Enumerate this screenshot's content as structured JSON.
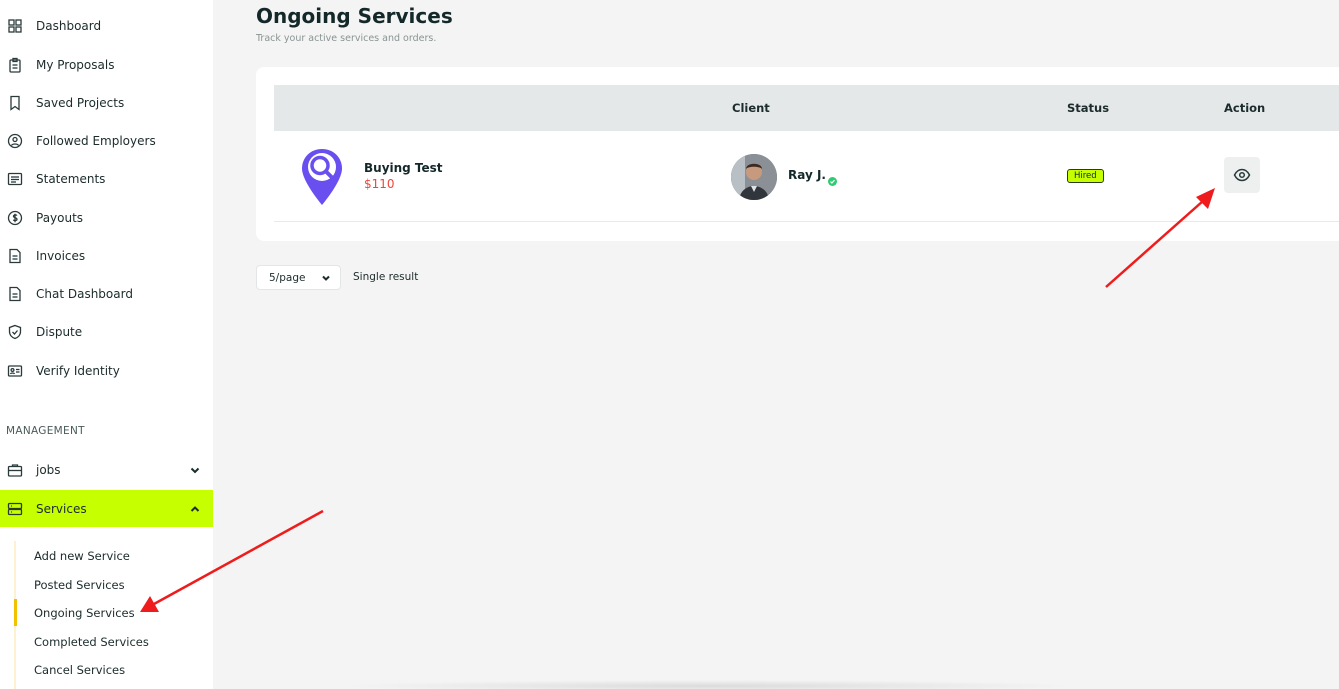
{
  "sidebar": {
    "items": [
      {
        "label": "Dashboard",
        "icon": "grid-icon"
      },
      {
        "label": "My Proposals",
        "icon": "clipboard-icon"
      },
      {
        "label": "Saved Projects",
        "icon": "bookmark-icon"
      },
      {
        "label": "Followed Employers",
        "icon": "user-follow-icon"
      },
      {
        "label": "Statements",
        "icon": "list-document-icon"
      },
      {
        "label": "Payouts",
        "icon": "dollar-circle-icon"
      },
      {
        "label": "Invoices",
        "icon": "invoice-document-icon"
      },
      {
        "label": "Chat Dashboard",
        "icon": "chat-document-icon"
      },
      {
        "label": "Dispute",
        "icon": "shield-check-icon"
      },
      {
        "label": "Verify Identity",
        "icon": "id-card-icon"
      }
    ],
    "section_title": "MANAGEMENT",
    "groups": [
      {
        "label": "jobs",
        "icon": "briefcase-icon",
        "expanded": false
      },
      {
        "label": "Services",
        "icon": "server-icon",
        "expanded": true
      }
    ],
    "sub_items": [
      "Add new Service",
      "Posted Services",
      "Ongoing Services",
      "Completed Services",
      "Cancel Services"
    ],
    "active_sub_item": "Ongoing Services"
  },
  "main": {
    "title": "Ongoing Services",
    "subtitle": "Track your active services and orders.",
    "table": {
      "headers": {
        "client": "Client",
        "status": "Status",
        "action": "Action"
      },
      "rows": [
        {
          "service_name": "Buying Test",
          "price": "$110",
          "client_name": "Ray J.",
          "status": "Hired"
        }
      ]
    },
    "pagination": {
      "per_page": "5/page",
      "result_text": "Single result"
    }
  },
  "colors": {
    "accent": "#c6ff00",
    "active_bar": "#f2c200",
    "price": "#f0453a",
    "logo": "#6a4ff0",
    "annotation_arrow": "#ee1c1c"
  }
}
